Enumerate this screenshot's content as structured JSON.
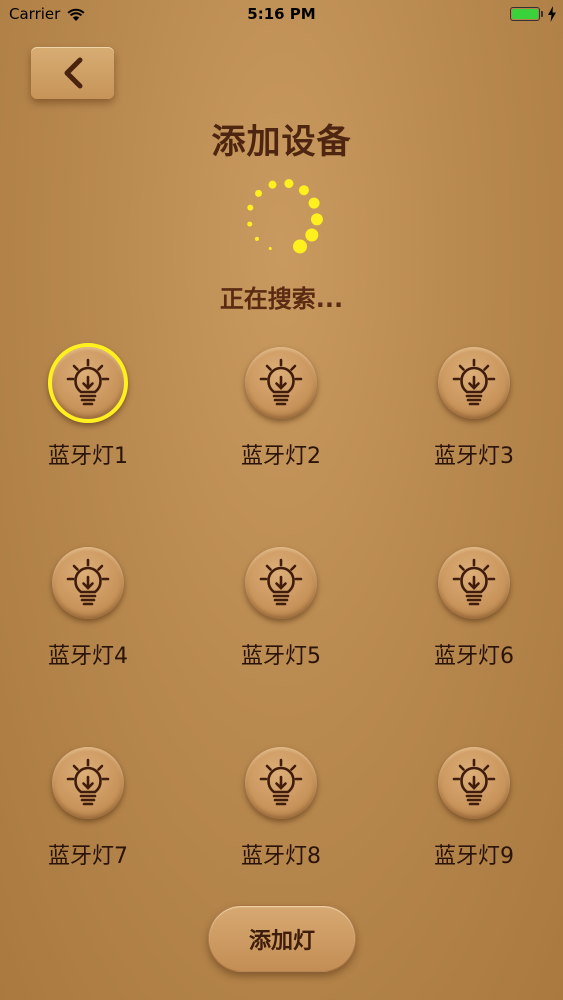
{
  "status_bar": {
    "carrier": "Carrier",
    "time": "5:16 PM",
    "battery_color": "#3ad23a"
  },
  "header": {
    "back_icon": "chevron-left-icon",
    "title": "添加设备"
  },
  "search": {
    "status": "正在搜索...",
    "spinner_color": "#fff01e"
  },
  "devices": [
    {
      "label": "蓝牙灯1",
      "selected": true
    },
    {
      "label": "蓝牙灯2",
      "selected": false
    },
    {
      "label": "蓝牙灯3",
      "selected": false
    },
    {
      "label": "蓝牙灯4",
      "selected": false
    },
    {
      "label": "蓝牙灯5",
      "selected": false
    },
    {
      "label": "蓝牙灯6",
      "selected": false
    },
    {
      "label": "蓝牙灯7",
      "selected": false
    },
    {
      "label": "蓝牙灯8",
      "selected": false
    },
    {
      "label": "蓝牙灯9",
      "selected": false
    }
  ],
  "footer": {
    "add_label": "添加灯"
  }
}
